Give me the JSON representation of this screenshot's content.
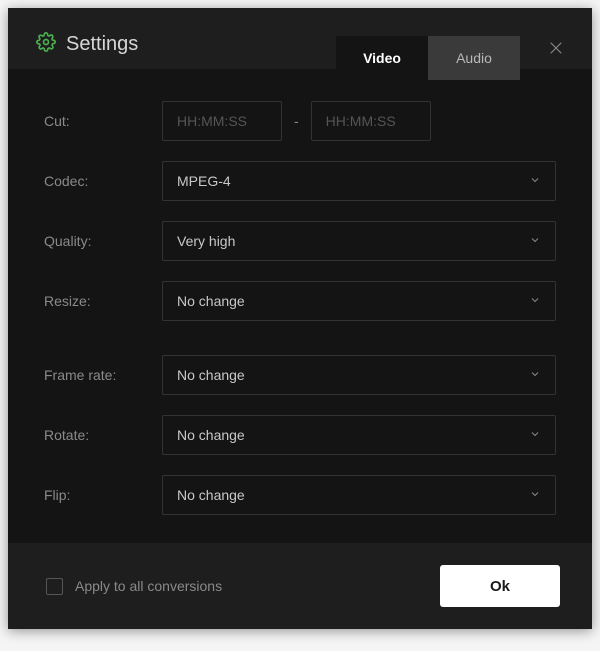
{
  "title": "Settings",
  "tabs": {
    "video": "Video",
    "audio": "Audio"
  },
  "fields": {
    "cut": {
      "label": "Cut:",
      "from_placeholder": "HH:MM:SS",
      "to_placeholder": "HH:MM:SS",
      "separator": "-"
    },
    "codec": {
      "label": "Codec:",
      "value": "MPEG-4"
    },
    "quality": {
      "label": "Quality:",
      "value": "Very high"
    },
    "resize": {
      "label": "Resize:",
      "value": "No change"
    },
    "framerate": {
      "label": "Frame rate:",
      "value": "No change"
    },
    "rotate": {
      "label": "Rotate:",
      "value": "No change"
    },
    "flip": {
      "label": "Flip:",
      "value": "No change"
    }
  },
  "footer": {
    "apply_all_label": "Apply to all conversions",
    "ok_label": "Ok"
  },
  "colors": {
    "accent": "#4caf50"
  }
}
